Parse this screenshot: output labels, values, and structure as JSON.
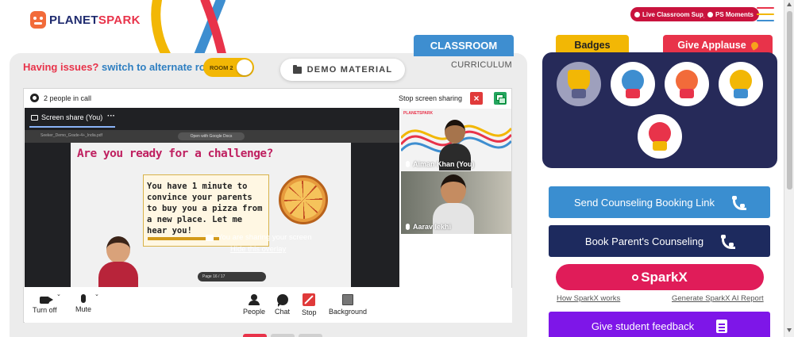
{
  "header": {
    "logo_primary": "PLANET",
    "logo_secondary": "SPARK",
    "live_support": "Live Classroom Support",
    "ps_moments": "PS Moments"
  },
  "tabs": {
    "classroom": "CLASSROOM",
    "curriculum": "CURRICULUM"
  },
  "toolbar": {
    "issues_question": "Having issues?",
    "issues_switch": "switch to alternate room",
    "room_toggle": "ROOM 2",
    "demo_material": "DEMO MATERIAL"
  },
  "meeting": {
    "people_in_call": "2 people in call",
    "stop_sharing": "Stop screen sharing",
    "screen_share_tab": "Screen share (You)",
    "sharing_message": "You are sharing your screen",
    "hide_overlay": "Hide this overlay",
    "slide_filename": "Seeker_Demo_Grade-4+_India.pdf",
    "slide_open_with": "Open with Google Docs",
    "slide_title": "Are you ready for a challenge?",
    "slide_text": "You have 1 minute to convince your parents to buy you a pizza from a new place. Let me hear you!",
    "slide_page": "Page 16 / 17",
    "tiles": [
      {
        "name": "Aiman Khan (You)"
      },
      {
        "name": "Aarav lekhi"
      }
    ],
    "tile_logo": "PLANETSPARK",
    "controls": [
      {
        "label": "Turn off",
        "icon": "camera-icon"
      },
      {
        "label": "Mute",
        "icon": "microphone-icon"
      },
      {
        "label": "People",
        "icon": "people-icon"
      },
      {
        "label": "Chat",
        "icon": "chat-icon"
      },
      {
        "label": "Stop",
        "icon": "stop-share-icon"
      },
      {
        "label": "Background",
        "icon": "background-icon"
      }
    ]
  },
  "right_panel": {
    "badges_tab": "Badges",
    "applause_tab": "Give Applause",
    "badges": [
      {
        "icon": "trophy-badge-icon",
        "state": "earned"
      },
      {
        "icon": "robot-badge-icon",
        "state": "available"
      },
      {
        "icon": "yoga-badge-icon",
        "state": "available"
      },
      {
        "icon": "ideas-badge-icon",
        "state": "available"
      },
      {
        "icon": "brain-badge-icon",
        "state": "available"
      }
    ],
    "send_counseling": "Send Counseling Booking Link",
    "book_counseling": "Book Parent's Counseling",
    "sparkx": "SparkX",
    "how_sparkx": "How SparkX works",
    "generate_report": "Generate SparkX AI Report",
    "give_feedback": "Give student feedback"
  },
  "colors": {
    "brand_red": "#e8334a",
    "brand_navy": "#1e2a6e",
    "classroom_blue": "#3e8ed0",
    "badge_yellow": "#f2b705",
    "counsel_blue": "#3a8ed0",
    "counsel_navy": "#1d2a5e",
    "sparkx_pink": "#e01c59",
    "feedback_purple": "#7e16e8"
  }
}
